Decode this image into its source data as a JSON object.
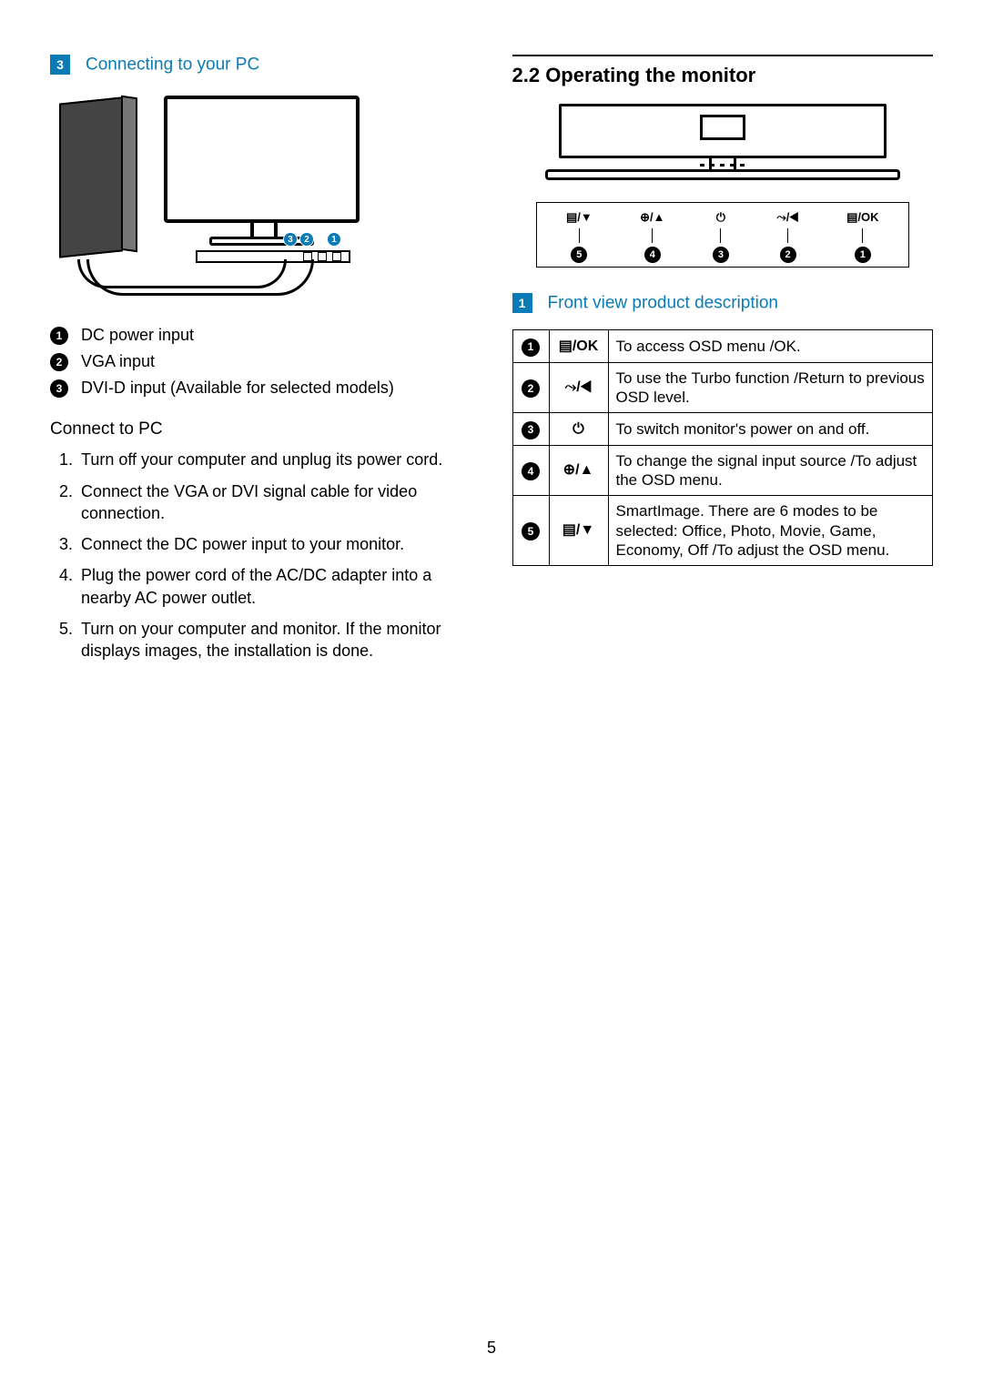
{
  "page_number": "5",
  "left": {
    "callout_number": "3",
    "callout_title": "Connecting to your PC",
    "figure_port_labels": [
      "3",
      "2",
      "1"
    ],
    "port_list": [
      {
        "num": "1",
        "label": "DC power input"
      },
      {
        "num": "2",
        "label": "VGA input"
      },
      {
        "num": "3",
        "label": "DVI-D input (Available for selected models)"
      }
    ],
    "connect_heading": "Connect to PC",
    "steps": [
      "Turn off your computer and unplug its power cord.",
      "Connect the VGA or DVI signal cable for video connection.",
      "Connect the DC power input to your monitor.",
      "Plug the power cord of the AC/DC adapter into a nearby AC power outlet.",
      "Turn on your computer and monitor. If the monitor displays images, the installation is done."
    ]
  },
  "right": {
    "section_heading": "2.2  Operating the monitor",
    "buttons": [
      {
        "symbol": "▤⁠/▼",
        "num": "5"
      },
      {
        "symbol": "⊕/▲",
        "num": "4"
      },
      {
        "symbol": "⏻",
        "num": "3"
      },
      {
        "symbol": "⤳/◀",
        "num": "2"
      },
      {
        "symbol": "▤/OK",
        "num": "1"
      }
    ],
    "callout_number": "1",
    "callout_title": "Front view product description",
    "table": [
      {
        "num": "1",
        "symbol": "▤/OK",
        "desc": "To access OSD menu /OK."
      },
      {
        "num": "2",
        "symbol": "⤳/◀",
        "desc": "To use the Turbo function /Return to previous OSD level."
      },
      {
        "num": "3",
        "symbol": "⏻",
        "desc": "To switch monitor's power on and off."
      },
      {
        "num": "4",
        "symbol": "⊕/▲",
        "desc": "To change the signal input source /To adjust the OSD menu."
      },
      {
        "num": "5",
        "symbol": "▤⁠/▼",
        "desc": "SmartImage. There are 6 modes to be selected: Office, Photo, Movie, Game, Economy, Off /To adjust the OSD menu."
      }
    ]
  }
}
